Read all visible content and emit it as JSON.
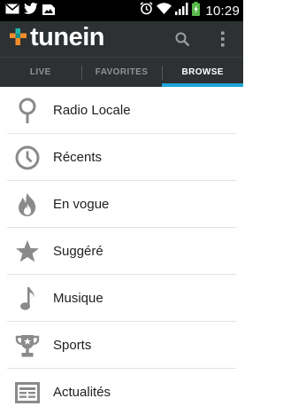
{
  "status_bar": {
    "time": "10:29",
    "left_icons": [
      "mail-icon",
      "twitter-icon",
      "image-icon"
    ],
    "right_icons": [
      "alarm-icon",
      "wifi-icon",
      "signal-icon",
      "battery-charging-icon"
    ]
  },
  "app": {
    "brand": "tunein",
    "colors": {
      "bar": "#2d3134",
      "accent": "#20a4d6",
      "logo_orange": "#f58d2b",
      "logo_teal": "#20b7b1"
    }
  },
  "tabs": [
    {
      "label": "LIVE",
      "active": false
    },
    {
      "label": "FAVORITES",
      "active": false
    },
    {
      "label": "BROWSE",
      "active": true
    }
  ],
  "browse_items": [
    {
      "label": "Radio Locale",
      "icon": "location-pin-icon"
    },
    {
      "label": "Récents",
      "icon": "clock-icon"
    },
    {
      "label": "En vogue",
      "icon": "flame-icon"
    },
    {
      "label": "Suggéré",
      "icon": "star-icon"
    },
    {
      "label": "Musique",
      "icon": "music-note-icon"
    },
    {
      "label": "Sports",
      "icon": "trophy-icon"
    },
    {
      "label": "Actualités",
      "icon": "newspaper-icon"
    }
  ]
}
